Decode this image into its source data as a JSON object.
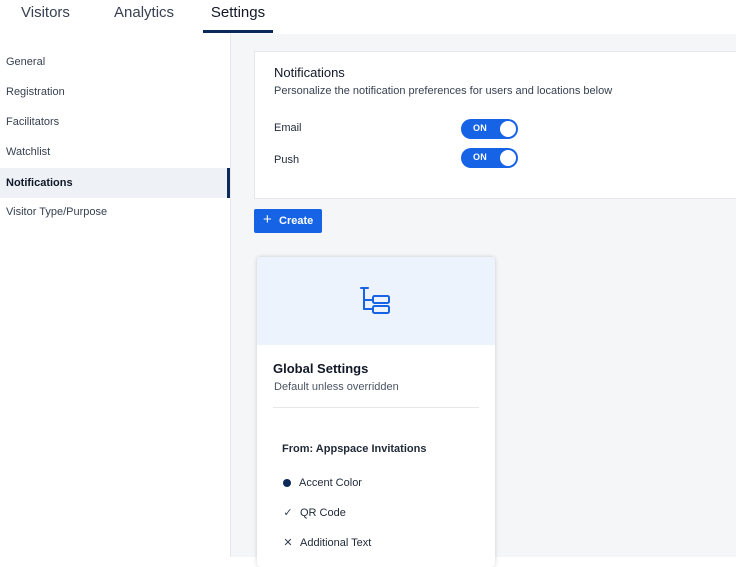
{
  "tabs": [
    "Visitors",
    "Analytics",
    "Settings"
  ],
  "active_tab": "Settings",
  "sidebar": {
    "items": [
      "General",
      "Registration",
      "Facilitators",
      "Watchlist",
      "Notifications",
      "Visitor Type/Purpose"
    ],
    "active": "Notifications"
  },
  "notifications": {
    "title": "Notifications",
    "description": "Personalize the notification preferences for users and locations below",
    "rows": [
      {
        "label": "Email",
        "state": "ON"
      },
      {
        "label": "Push",
        "state": "ON"
      }
    ]
  },
  "create_button": {
    "icon": "plus-icon",
    "label": "Create"
  },
  "card": {
    "icon": "hierarchy-icon",
    "title": "Global Settings",
    "subtitle": "Default unless overridden",
    "from": "From: Appspace Invitations",
    "features": [
      {
        "icon": "dot-icon",
        "label": "Accent Color"
      },
      {
        "icon": "check-icon",
        "label": "QR Code"
      },
      {
        "icon": "x-icon",
        "label": "Additional Text"
      }
    ]
  },
  "colors": {
    "accent": "#1663e6",
    "navy": "#0b2a5a",
    "card_header": "#edf3fc",
    "main_bg": "#f5f6f8"
  }
}
